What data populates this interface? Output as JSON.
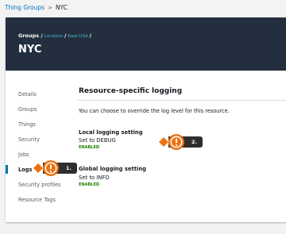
{
  "breadcrumb": {
    "root": "Thing Groups",
    "separator": ">",
    "current": "NYC"
  },
  "header": {
    "crumb_groups": "Groups /",
    "crumb_location": "Location",
    "crumb_sep1": "/",
    "crumb_region": "East-USA",
    "crumb_sep2": "/",
    "title": "NYC"
  },
  "sidebar": {
    "items": [
      {
        "label": "Details"
      },
      {
        "label": "Groups"
      },
      {
        "label": "Things"
      },
      {
        "label": "Security"
      },
      {
        "label": "Jobs"
      },
      {
        "label": "Logs"
      },
      {
        "label": "Security profiles"
      },
      {
        "label": "Resource Tags"
      }
    ],
    "active": "Logs"
  },
  "main": {
    "section_title": "Resource-specific logging",
    "description": "You can choose to override the log level for this resource.",
    "local": {
      "label": "Local logging setting",
      "value": "Set to DEBUG",
      "status": "ENABLED"
    },
    "global": {
      "label": "Global logging setting",
      "value": "Set to INFO",
      "status": "ENABLED"
    }
  },
  "callouts": {
    "one": "1.",
    "two": "2."
  },
  "colors": {
    "accent": "#0073bb",
    "header_bg": "#232f3e",
    "enabled": "#1d8102",
    "callout": "#ec7211"
  },
  "icons": {
    "callout": "exclamation-icon"
  }
}
